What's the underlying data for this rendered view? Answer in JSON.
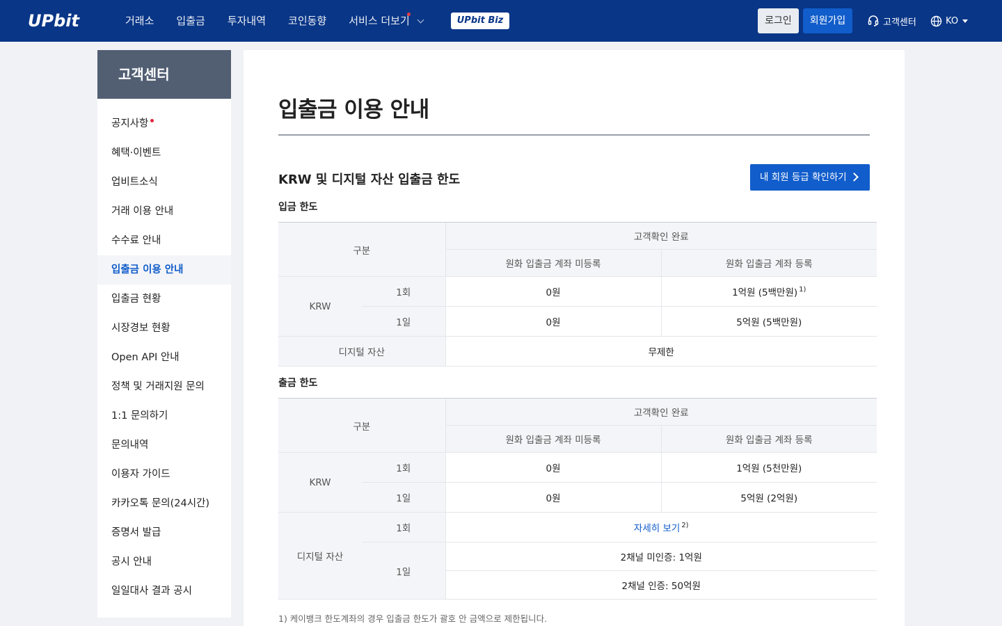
{
  "header": {
    "logo": "UPbit",
    "nav": [
      "거래소",
      "입출금",
      "투자내역",
      "코인동향",
      "서비스 더보기"
    ],
    "biz": "UPbit Biz",
    "login": "로그인",
    "join": "회원가입",
    "support": "고객센터",
    "lang": "KO"
  },
  "sidebar": {
    "title": "고객센터",
    "items": [
      {
        "label": "공지사항"
      },
      {
        "label": "혜택·이벤트"
      },
      {
        "label": "업비트소식"
      },
      {
        "label": "거래 이용 안내"
      },
      {
        "label": "수수료 안내"
      },
      {
        "label": "입출금 이용 안내"
      },
      {
        "label": "입출금 현황"
      },
      {
        "label": "시장경보 현황"
      },
      {
        "label": "Open API 안내"
      },
      {
        "label": "정책 및 거래지원 문의"
      },
      {
        "label": "1:1 문의하기"
      },
      {
        "label": "문의내역"
      },
      {
        "label": "이용자 가이드"
      },
      {
        "label": "카카오톡 문의(24시간)"
      },
      {
        "label": "증명서 발급"
      },
      {
        "label": "공시 안내"
      },
      {
        "label": "일일대사 결과 공시"
      }
    ]
  },
  "main": {
    "title": "입출금 이용 안내",
    "section_title": "KRW 및 디지털 자산 입출금 한도",
    "grade_button": "내 회원 등급 확인하기",
    "deposit": {
      "title": "입금 한도",
      "h_category": "구분",
      "h_verified": "고객확인 완료",
      "h_unreg": "원화 입출금 계좌 미등록",
      "h_reg": "원화 입출금 계좌 등록",
      "krw": "KRW",
      "once": "1회",
      "daily": "1일",
      "krw_once_unreg": "0원",
      "krw_once_reg": "1억원 (5백만원)",
      "krw_once_reg_sup": "1)",
      "krw_daily_unreg": "0원",
      "krw_daily_reg": "5억원 (5백만원)",
      "digital": "디지털 자산",
      "digital_val": "무제한"
    },
    "withdraw": {
      "title": "출금 한도",
      "h_category": "구분",
      "h_verified": "고객확인 완료",
      "h_unreg": "원화 입출금 계좌 미등록",
      "h_reg": "원화 입출금 계좌 등록",
      "krw": "KRW",
      "once": "1회",
      "daily": "1일",
      "krw_once_unreg": "0원",
      "krw_once_reg": "1억원 (5천만원)",
      "krw_daily_unreg": "0원",
      "krw_daily_reg": "5억원 (2억원)",
      "digital": "디지털 자산",
      "digital_once": "1회",
      "digital_daily": "1일",
      "digital_once_val": "자세히 보기",
      "digital_once_sup": "2)",
      "digital_daily_val1": "2채널 미인증: 1억원",
      "digital_daily_val2": "2채널 인증: 50억원"
    },
    "footnote": "1)  케이뱅크 한도계좌의 경우 입출금 한도가 괄호 안 금액으로 제한됩니다."
  }
}
